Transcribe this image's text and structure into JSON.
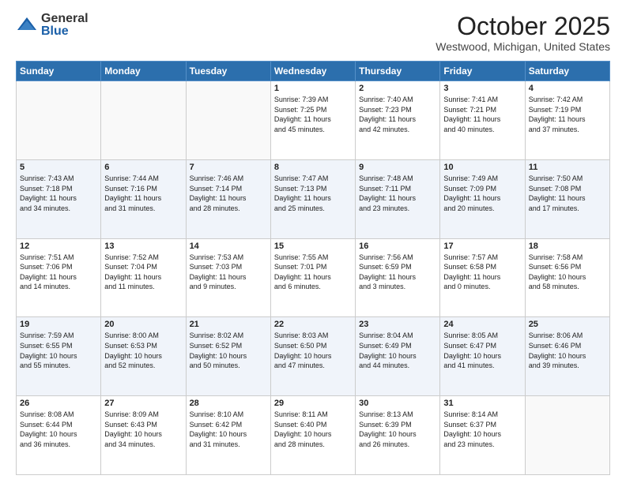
{
  "header": {
    "logo_general": "General",
    "logo_blue": "Blue",
    "month_title": "October 2025",
    "location": "Westwood, Michigan, United States"
  },
  "days_of_week": [
    "Sunday",
    "Monday",
    "Tuesday",
    "Wednesday",
    "Thursday",
    "Friday",
    "Saturday"
  ],
  "weeks": [
    {
      "shade": false,
      "days": [
        {
          "num": "",
          "info": ""
        },
        {
          "num": "",
          "info": ""
        },
        {
          "num": "",
          "info": ""
        },
        {
          "num": "1",
          "info": "Sunrise: 7:39 AM\nSunset: 7:25 PM\nDaylight: 11 hours\nand 45 minutes."
        },
        {
          "num": "2",
          "info": "Sunrise: 7:40 AM\nSunset: 7:23 PM\nDaylight: 11 hours\nand 42 minutes."
        },
        {
          "num": "3",
          "info": "Sunrise: 7:41 AM\nSunset: 7:21 PM\nDaylight: 11 hours\nand 40 minutes."
        },
        {
          "num": "4",
          "info": "Sunrise: 7:42 AM\nSunset: 7:19 PM\nDaylight: 11 hours\nand 37 minutes."
        }
      ]
    },
    {
      "shade": true,
      "days": [
        {
          "num": "5",
          "info": "Sunrise: 7:43 AM\nSunset: 7:18 PM\nDaylight: 11 hours\nand 34 minutes."
        },
        {
          "num": "6",
          "info": "Sunrise: 7:44 AM\nSunset: 7:16 PM\nDaylight: 11 hours\nand 31 minutes."
        },
        {
          "num": "7",
          "info": "Sunrise: 7:46 AM\nSunset: 7:14 PM\nDaylight: 11 hours\nand 28 minutes."
        },
        {
          "num": "8",
          "info": "Sunrise: 7:47 AM\nSunset: 7:13 PM\nDaylight: 11 hours\nand 25 minutes."
        },
        {
          "num": "9",
          "info": "Sunrise: 7:48 AM\nSunset: 7:11 PM\nDaylight: 11 hours\nand 23 minutes."
        },
        {
          "num": "10",
          "info": "Sunrise: 7:49 AM\nSunset: 7:09 PM\nDaylight: 11 hours\nand 20 minutes."
        },
        {
          "num": "11",
          "info": "Sunrise: 7:50 AM\nSunset: 7:08 PM\nDaylight: 11 hours\nand 17 minutes."
        }
      ]
    },
    {
      "shade": false,
      "days": [
        {
          "num": "12",
          "info": "Sunrise: 7:51 AM\nSunset: 7:06 PM\nDaylight: 11 hours\nand 14 minutes."
        },
        {
          "num": "13",
          "info": "Sunrise: 7:52 AM\nSunset: 7:04 PM\nDaylight: 11 hours\nand 11 minutes."
        },
        {
          "num": "14",
          "info": "Sunrise: 7:53 AM\nSunset: 7:03 PM\nDaylight: 11 hours\nand 9 minutes."
        },
        {
          "num": "15",
          "info": "Sunrise: 7:55 AM\nSunset: 7:01 PM\nDaylight: 11 hours\nand 6 minutes."
        },
        {
          "num": "16",
          "info": "Sunrise: 7:56 AM\nSunset: 6:59 PM\nDaylight: 11 hours\nand 3 minutes."
        },
        {
          "num": "17",
          "info": "Sunrise: 7:57 AM\nSunset: 6:58 PM\nDaylight: 11 hours\nand 0 minutes."
        },
        {
          "num": "18",
          "info": "Sunrise: 7:58 AM\nSunset: 6:56 PM\nDaylight: 10 hours\nand 58 minutes."
        }
      ]
    },
    {
      "shade": true,
      "days": [
        {
          "num": "19",
          "info": "Sunrise: 7:59 AM\nSunset: 6:55 PM\nDaylight: 10 hours\nand 55 minutes."
        },
        {
          "num": "20",
          "info": "Sunrise: 8:00 AM\nSunset: 6:53 PM\nDaylight: 10 hours\nand 52 minutes."
        },
        {
          "num": "21",
          "info": "Sunrise: 8:02 AM\nSunset: 6:52 PM\nDaylight: 10 hours\nand 50 minutes."
        },
        {
          "num": "22",
          "info": "Sunrise: 8:03 AM\nSunset: 6:50 PM\nDaylight: 10 hours\nand 47 minutes."
        },
        {
          "num": "23",
          "info": "Sunrise: 8:04 AM\nSunset: 6:49 PM\nDaylight: 10 hours\nand 44 minutes."
        },
        {
          "num": "24",
          "info": "Sunrise: 8:05 AM\nSunset: 6:47 PM\nDaylight: 10 hours\nand 41 minutes."
        },
        {
          "num": "25",
          "info": "Sunrise: 8:06 AM\nSunset: 6:46 PM\nDaylight: 10 hours\nand 39 minutes."
        }
      ]
    },
    {
      "shade": false,
      "days": [
        {
          "num": "26",
          "info": "Sunrise: 8:08 AM\nSunset: 6:44 PM\nDaylight: 10 hours\nand 36 minutes."
        },
        {
          "num": "27",
          "info": "Sunrise: 8:09 AM\nSunset: 6:43 PM\nDaylight: 10 hours\nand 34 minutes."
        },
        {
          "num": "28",
          "info": "Sunrise: 8:10 AM\nSunset: 6:42 PM\nDaylight: 10 hours\nand 31 minutes."
        },
        {
          "num": "29",
          "info": "Sunrise: 8:11 AM\nSunset: 6:40 PM\nDaylight: 10 hours\nand 28 minutes."
        },
        {
          "num": "30",
          "info": "Sunrise: 8:13 AM\nSunset: 6:39 PM\nDaylight: 10 hours\nand 26 minutes."
        },
        {
          "num": "31",
          "info": "Sunrise: 8:14 AM\nSunset: 6:37 PM\nDaylight: 10 hours\nand 23 minutes."
        },
        {
          "num": "",
          "info": ""
        }
      ]
    }
  ]
}
